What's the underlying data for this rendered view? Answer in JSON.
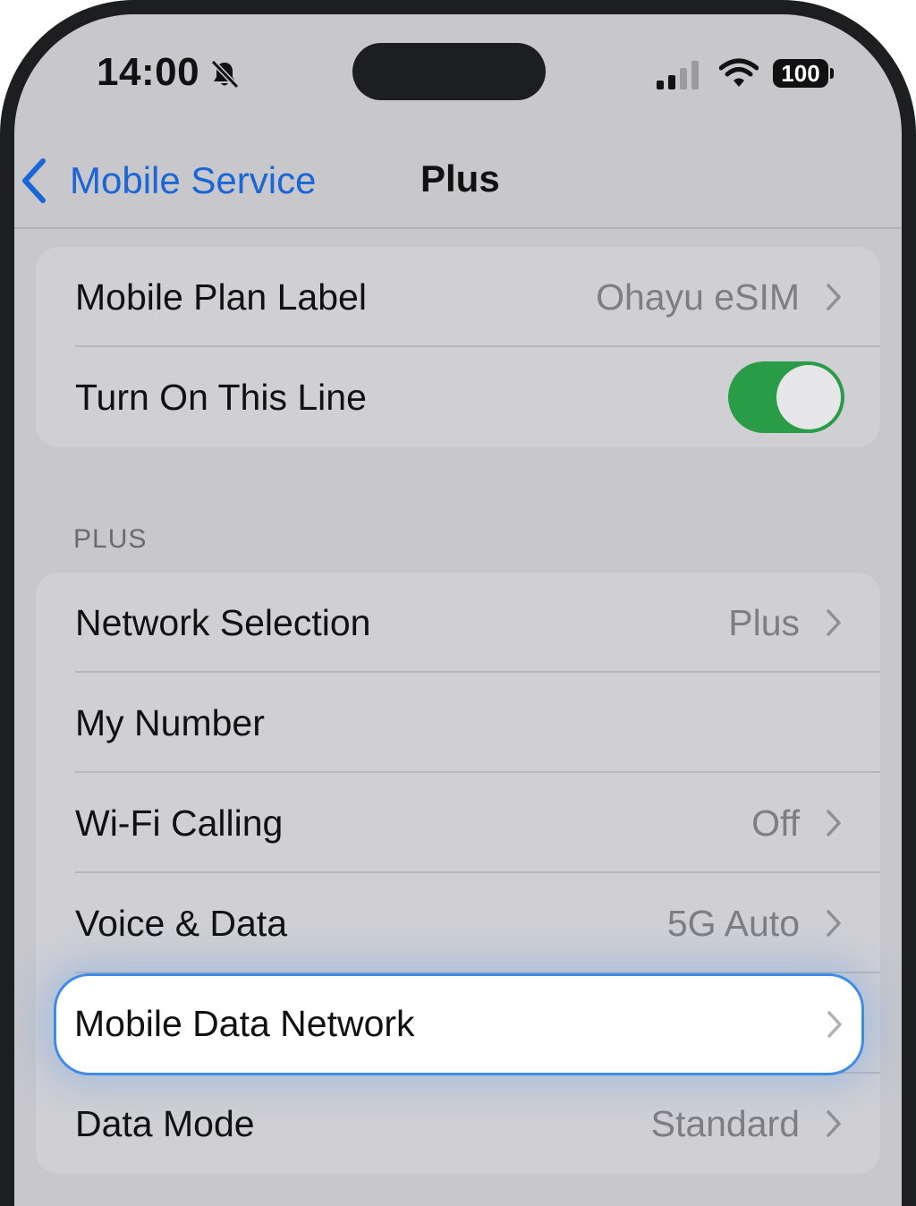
{
  "status_bar": {
    "time": "14:00",
    "battery": "100",
    "icons": [
      "bell-slash-icon",
      "cellular-signal-icon",
      "wifi-icon",
      "battery-icon"
    ]
  },
  "nav": {
    "back_label": "Mobile Service",
    "title": "Plus"
  },
  "group1": [
    {
      "label": "Mobile Plan Label",
      "value": "Ohayu eSIM"
    },
    {
      "label": "Turn On This Line",
      "toggle": true
    }
  ],
  "section_header": "PLUS",
  "group2": [
    {
      "label": "Network Selection",
      "value": "Plus"
    },
    {
      "label": "My Number",
      "value": ""
    },
    {
      "label": "Wi-Fi Calling",
      "value": "Off"
    },
    {
      "label": "Voice & Data",
      "value": "5G Auto"
    },
    {
      "label": "Mobile Data Network",
      "value": "",
      "highlighted": true
    },
    {
      "label": "Data Mode",
      "value": "Standard"
    }
  ],
  "colors": {
    "accent": "#1a66d6",
    "toggle_on": "#2a9b47",
    "highlight_border": "#3f8ce8"
  }
}
